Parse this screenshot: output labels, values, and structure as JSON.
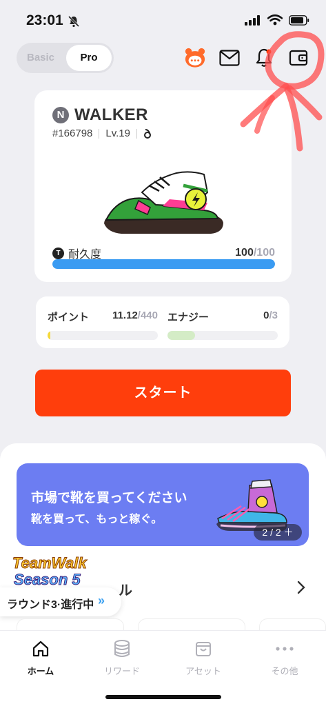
{
  "status_bar": {
    "time": "23:01"
  },
  "mode_toggle": {
    "basic": "Basic",
    "pro": "Pro"
  },
  "top_icons": [
    "mascot-chat-icon",
    "mail-icon",
    "bell-icon",
    "wallet-icon"
  ],
  "sneaker": {
    "badge": "N",
    "name": "WALKER",
    "id": "#166798",
    "level": "Lv.19",
    "durability_label": "耐久度",
    "durability_badge": "T",
    "durability_value": "100",
    "durability_max": "/100",
    "durability_fraction": 1.0
  },
  "stats": {
    "points_label": "ポイント",
    "points_value": "11.12",
    "points_max": "/440",
    "points_fraction": 0.025,
    "energy_label": "エナジー",
    "energy_value": "0",
    "energy_max": "/3",
    "energy_fraction": 0.25
  },
  "start_button": "スタート",
  "banner": {
    "title": "市場で靴を買ってください",
    "subtitle": "靴を買って、もっと稼ぐ。",
    "pager": "2 / 2 ＋"
  },
  "section": {
    "partial_title": "ル"
  },
  "teamwalk": {
    "title": "TeamWalk",
    "season": "Season 5",
    "round": "ラウンド3·進行中",
    "chevron": "»"
  },
  "tabs": [
    {
      "label": "ホーム",
      "icon": "home-icon",
      "active": true
    },
    {
      "label": "リワード",
      "icon": "coins-icon",
      "active": false
    },
    {
      "label": "アセット",
      "icon": "bag-icon",
      "active": false
    },
    {
      "label": "その他",
      "icon": "more-icon",
      "active": false
    }
  ],
  "colors": {
    "accent": "#ff3e0c",
    "durability": "#3a9bf2",
    "banner": "#6c7df2",
    "annotation": "#ff4d4d"
  }
}
